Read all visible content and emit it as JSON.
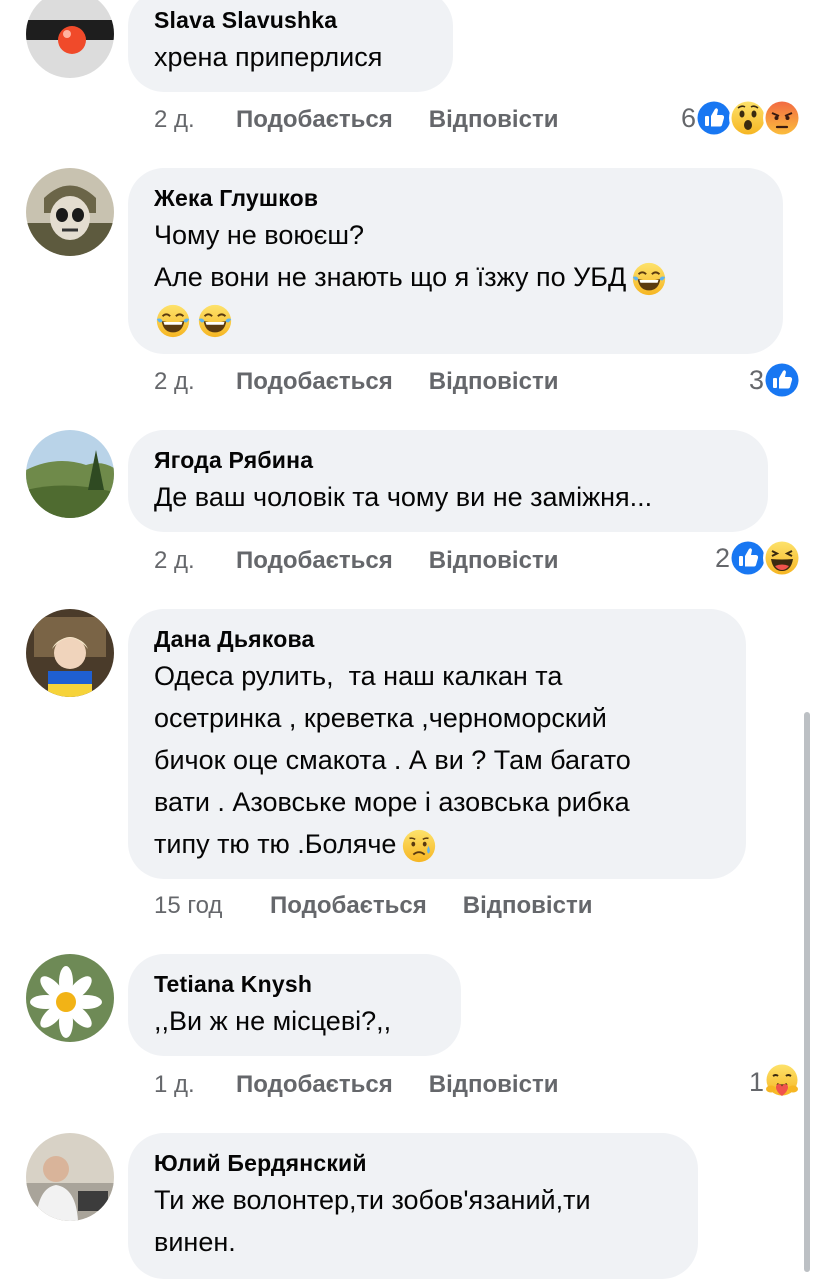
{
  "comments": [
    {
      "author": "Slava Slavushka",
      "lines": [
        "хрена приперлися"
      ],
      "time": "2 д.",
      "like_label": "Подобається",
      "reply_label": "Відповісти",
      "reaction_count": "6",
      "reactions": [
        "like-icon",
        "wow-icon",
        "angry-icon"
      ]
    },
    {
      "author": "Жека Глушков",
      "lines": [
        "Чому не воюєш?",
        "Але вони не знають що я їзжу по УБД"
      ],
      "time": "2 д.",
      "like_label": "Подобається",
      "reply_label": "Відповісти",
      "reaction_count": "3",
      "reactions": [
        "like-icon"
      ]
    },
    {
      "author": "Ягода Рябина",
      "lines": [
        "Де ваш чоловік та чому ви не заміжня..."
      ],
      "time": "2 д.",
      "like_label": "Подобається",
      "reply_label": "Відповісти",
      "reaction_count": "2",
      "reactions": [
        "like-icon",
        "haha-icon"
      ]
    },
    {
      "author": "Дана Дьякова",
      "lines": [
        "Одеса рулить,  та наш калкан та",
        "осетринка , креветка ,черноморский",
        "бичок оце смакота . А ви ? Там багато",
        "вати . Азовське море і азовська рибка",
        "типу тю тю .Боляче"
      ],
      "time": "15 год",
      "like_label": "Подобається",
      "reply_label": "Відповісти"
    },
    {
      "author": "Tetiana Knysh",
      "lines": [
        ",,Ви ж не місцеві?,,"
      ],
      "time": "1 д.",
      "like_label": "Подобається",
      "reply_label": "Відповісти",
      "reaction_count": "1",
      "reactions": [
        "care-icon"
      ]
    },
    {
      "author": "Юлий Бердянский",
      "lines": [
        "Ти же волонтер,ти зобов'язаний,ти",
        "винен."
      ]
    }
  ],
  "colors": {
    "bubble": "#f0f2f5",
    "meta_text": "#65676b",
    "like_blue": "#1877f2",
    "reaction_yellow": "#fcc93a",
    "angry_red": "#e9573e"
  }
}
